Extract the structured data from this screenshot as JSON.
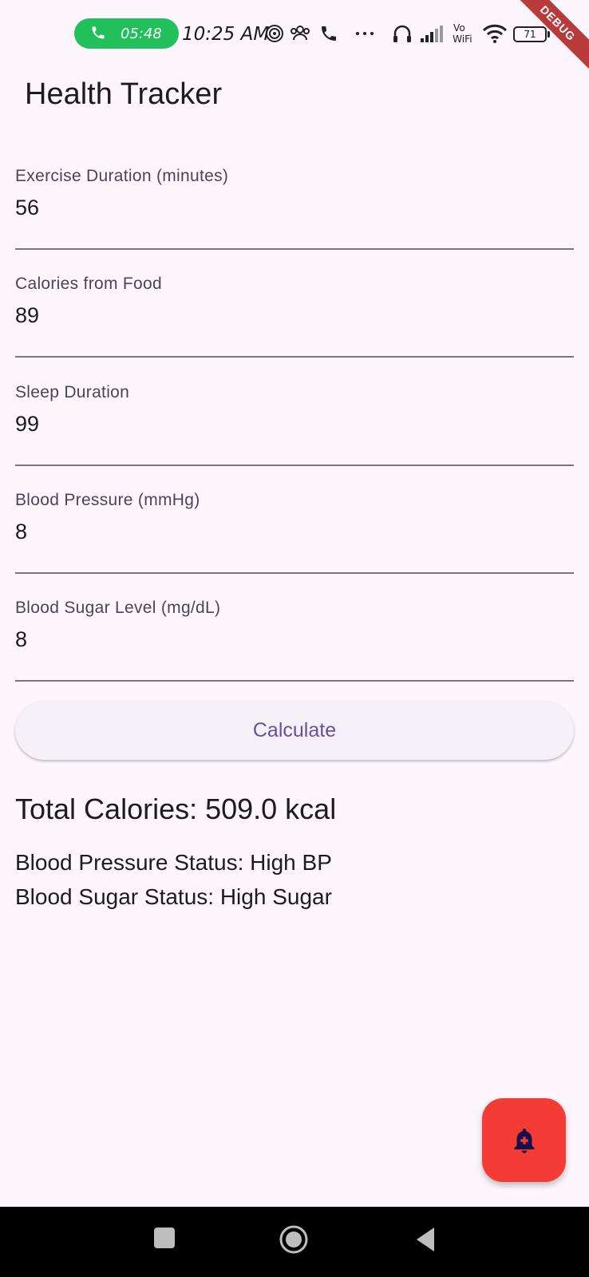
{
  "status_bar": {
    "call_timer": "05:48",
    "clock": "10:25 AM",
    "wifi_label": "Vo\nWiFi",
    "battery_level": "71",
    "debug_banner": "DEBUG"
  },
  "app_bar": {
    "title": "Health Tracker"
  },
  "form": {
    "fields": [
      {
        "label": "Exercise Duration (minutes)",
        "value": "56"
      },
      {
        "label": "Calories from Food",
        "value": "89"
      },
      {
        "label": "Sleep Duration",
        "value": "99"
      },
      {
        "label": "Blood Pressure (mmHg)",
        "value": "8"
      },
      {
        "label": "Blood Sugar Level (mg/dL)",
        "value": "8"
      }
    ],
    "calculate_label": "Calculate"
  },
  "results": {
    "total_calories": "Total Calories: 509.0 kcal",
    "bp_status": "Blood Pressure Status: High BP",
    "sugar_status": "Blood Sugar Status: High Sugar"
  },
  "fab": {
    "icon": "notification-add-icon"
  },
  "colors": {
    "background": "#fdf7fd",
    "accent": "#6750a4",
    "fab": "#f33c35",
    "call_pill": "#21c05a"
  }
}
